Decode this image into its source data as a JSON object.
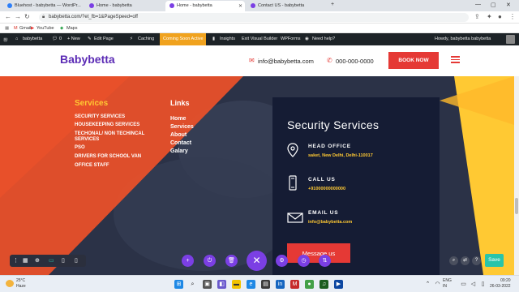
{
  "browser": {
    "tabs": [
      {
        "label": "Bluehost - babybetta — WordPr...",
        "color": "#2d7ff9"
      },
      {
        "label": "Home - babybetta",
        "color": "#7b3fe4"
      },
      {
        "label": "Home - babybetta",
        "color": "#7b3fe4"
      },
      {
        "label": "Contact US - babybetta",
        "color": "#7b3fe4"
      }
    ],
    "new_tab": "+",
    "url": "babybetta.com/?et_fb=1&PageSpeed=off",
    "bookmarks": [
      "Gmail",
      "YouTube",
      "Maps"
    ]
  },
  "wp_admin_bar": {
    "items": [
      "babybetta",
      "0",
      "+ New",
      "Edit Page",
      "Caching",
      "Insights",
      "Exit Visual Builder",
      "WPForms",
      "Need help?"
    ],
    "coming_soon": "Coming Soon Active",
    "greeting": "Howdy, babybetta babybetta"
  },
  "header": {
    "logo": "Babybetta",
    "email": "info@babybetta.com",
    "phone": "000-000-0000",
    "book_now": "BOOK NOW"
  },
  "services": {
    "title": "Services",
    "items": [
      "SECURITY SERVICES",
      "HOUSEKEEPING SERVICES",
      "TECHONAL/ NON TECHINCAL SERVICES",
      "PSO",
      "DRIVERS FOR SCHOOL VAN",
      "OFFICE STAFF"
    ]
  },
  "links": {
    "title": "Links",
    "items": [
      "Home",
      "Services",
      "About",
      "Contact",
      "Galary"
    ]
  },
  "contact_card": {
    "title": "Security Services",
    "head_office_label": "HEAD OFFICE",
    "head_office_value": "saket, New Delhi, Delhi-110017",
    "call_label": "CALL US",
    "call_value": "+91000000000000",
    "email_label": "EMAIL US",
    "email_value": "info@babybetta.com",
    "button": "Message us"
  },
  "builder": {
    "save": "Save"
  },
  "taskbar": {
    "weather_temp": "25°C",
    "weather_desc": "Haze",
    "lang1": "ENG",
    "lang2": "IN",
    "time": "09:20",
    "date": "26-03-2022"
  },
  "colors": {
    "accent_red": "#e53935",
    "brand_purple": "#5b2bb5",
    "accent_yellow": "#ffc933",
    "card_navy": "#151c34",
    "divi_purple": "#7b3fe4",
    "save_teal": "#29c4a9"
  }
}
